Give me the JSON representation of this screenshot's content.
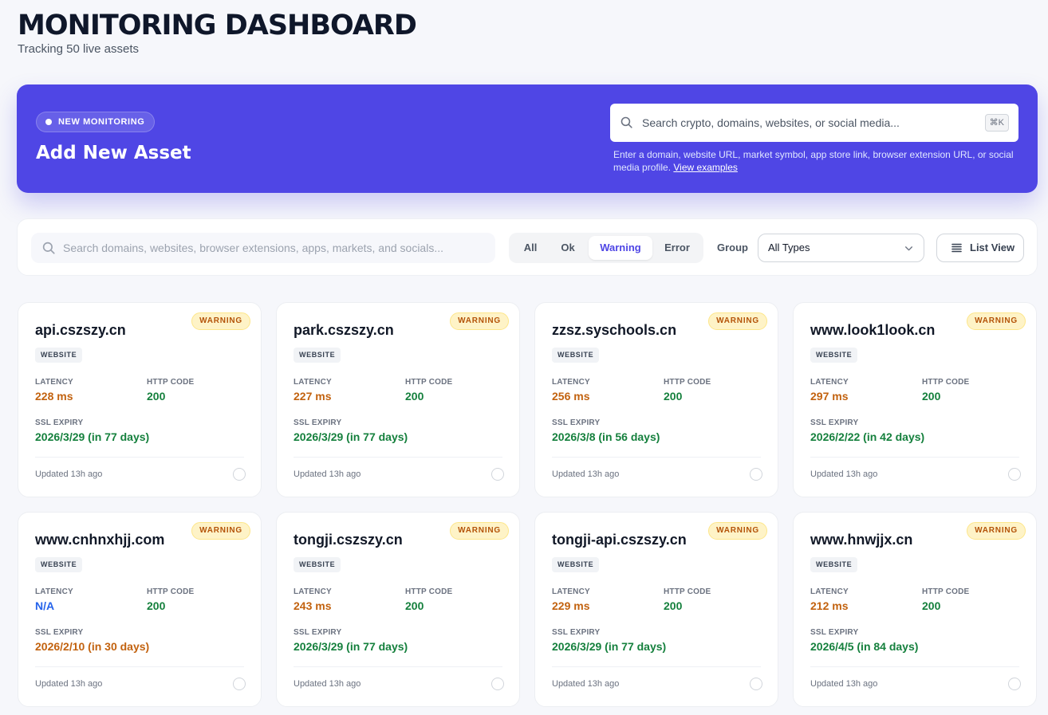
{
  "header": {
    "title": "MONITORING DASHBOARD",
    "subtitle": "Tracking 50 live assets"
  },
  "hero": {
    "badge": "NEW MONITORING",
    "title": "Add New Asset",
    "search_placeholder": "Search crypto, domains, websites, or social media...",
    "shortcut": "⌘K",
    "help_text": "Enter a domain, website URL, market symbol, app store link, browser extension URL, or social media profile.",
    "help_link": "View examples"
  },
  "filters": {
    "search_placeholder": "Search domains, websites, browser extensions, apps, markets, and socials...",
    "status_tabs": [
      {
        "label": "All",
        "active": false
      },
      {
        "label": "Ok",
        "active": false
      },
      {
        "label": "Warning",
        "active": true
      },
      {
        "label": "Error",
        "active": false
      }
    ],
    "group_label": "Group",
    "type_select_value": "All Types",
    "view_button": "List View"
  },
  "labels": {
    "latency": "LATENCY",
    "http_code": "HTTP CODE",
    "ssl_expiry": "SSL EXPIRY"
  },
  "colors": {
    "accent": "#4f46e5",
    "warning_bg": "#fef3c7",
    "warning_text": "#b45309",
    "ok": "#15803d",
    "caution": "#c2620f",
    "na": "#2563eb"
  },
  "cards": [
    {
      "name": "api.cszszy.cn",
      "status": "WARNING",
      "type": "WEBSITE",
      "latency": "228 ms",
      "latency_tone": "orange",
      "http": "200",
      "ssl": "2026/3/29 (in 77 days)",
      "ssl_tone": "green",
      "updated": "Updated 13h ago"
    },
    {
      "name": "park.cszszy.cn",
      "status": "WARNING",
      "type": "WEBSITE",
      "latency": "227 ms",
      "latency_tone": "orange",
      "http": "200",
      "ssl": "2026/3/29 (in 77 days)",
      "ssl_tone": "green",
      "updated": "Updated 13h ago"
    },
    {
      "name": "zzsz.syschools.cn",
      "status": "WARNING",
      "type": "WEBSITE",
      "latency": "256 ms",
      "latency_tone": "orange",
      "http": "200",
      "ssl": "2026/3/8 (in 56 days)",
      "ssl_tone": "green",
      "updated": "Updated 13h ago"
    },
    {
      "name": "www.look1look.cn",
      "status": "WARNING",
      "type": "WEBSITE",
      "latency": "297 ms",
      "latency_tone": "orange",
      "http": "200",
      "ssl": "2026/2/22 (in 42 days)",
      "ssl_tone": "green",
      "updated": "Updated 13h ago"
    },
    {
      "name": "www.cnhnxhjj.com",
      "status": "WARNING",
      "type": "WEBSITE",
      "latency": "N/A",
      "latency_tone": "blue",
      "http": "200",
      "ssl": "2026/2/10 (in 30 days)",
      "ssl_tone": "orange",
      "updated": "Updated 13h ago"
    },
    {
      "name": "tongji.cszszy.cn",
      "status": "WARNING",
      "type": "WEBSITE",
      "latency": "243 ms",
      "latency_tone": "orange",
      "http": "200",
      "ssl": "2026/3/29 (in 77 days)",
      "ssl_tone": "green",
      "updated": "Updated 13h ago"
    },
    {
      "name": "tongji-api.cszszy.cn",
      "status": "WARNING",
      "type": "WEBSITE",
      "latency": "229 ms",
      "latency_tone": "orange",
      "http": "200",
      "ssl": "2026/3/29 (in 77 days)",
      "ssl_tone": "green",
      "updated": "Updated 13h ago"
    },
    {
      "name": "www.hnwjjx.cn",
      "status": "WARNING",
      "type": "WEBSITE",
      "latency": "212 ms",
      "latency_tone": "orange",
      "http": "200",
      "ssl": "2026/4/5 (in 84 days)",
      "ssl_tone": "green",
      "updated": "Updated 13h ago"
    }
  ]
}
